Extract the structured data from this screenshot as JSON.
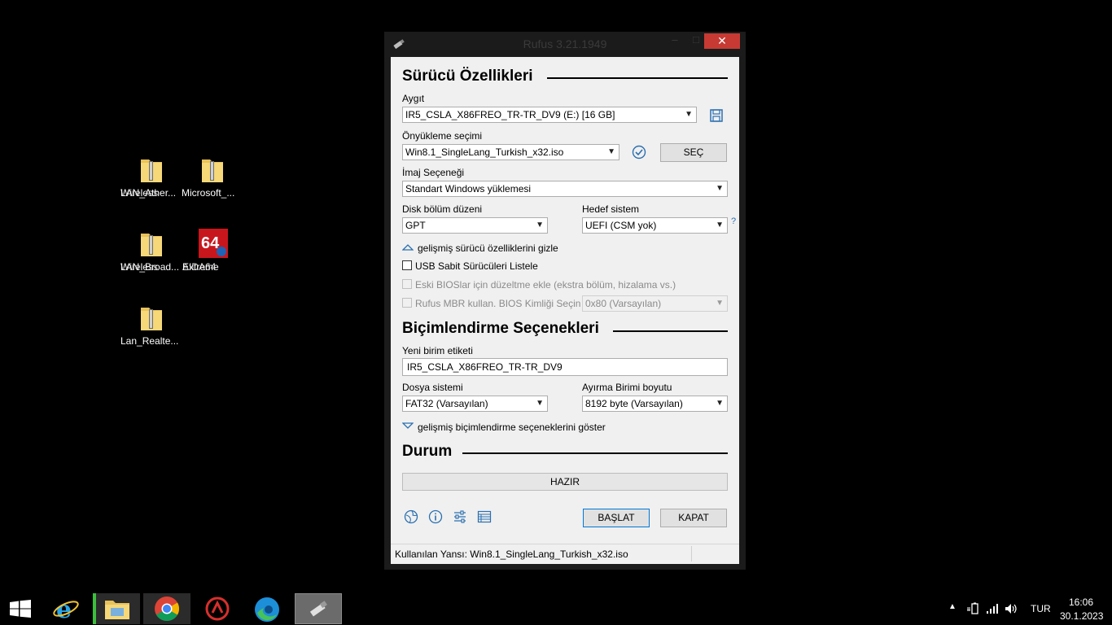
{
  "desktop": {
    "icons": [
      {
        "label1": "Wireless",
        "label2": "LAN_Ather..."
      },
      {
        "label1": "Microsoft_...",
        "label2": ""
      },
      {
        "label1": "Wireless",
        "label2": "LAN_Broad..."
      },
      {
        "label1": "AIDA64",
        "label2": "Extreme"
      },
      {
        "label1": "Lan_Realte...",
        "label2": ""
      }
    ]
  },
  "window": {
    "title": "Rufus 3.21.1949",
    "minimize": "–",
    "maximize": "□",
    "close": "✕"
  },
  "drive": {
    "section_title": "Sürücü Özellikleri",
    "device_label": "Aygıt",
    "device_value": "IR5_CSLA_X86FREO_TR-TR_DV9 (E:) [16 GB]",
    "boot_label": "Önyükleme seçimi",
    "boot_value": "Win8.1_SingleLang_Turkish_x32.iso",
    "select_button": "SEÇ",
    "image_option_label": "İmaj Seçeneği",
    "image_option_value": "Standart Windows yüklemesi",
    "partition_label": "Disk bölüm düzeni",
    "partition_value": "GPT",
    "target_label": "Hedef sistem",
    "target_value": "UEFI (CSM yok)",
    "help_mark": "?",
    "advanced_toggle": "gelişmiş sürücü özelliklerini gizle",
    "usb_list_label": "USB Sabit Sürücüleri Listele",
    "old_bios_label": "Eski BIOSlar için düzeltme ekle (ekstra bölüm, hizalama vs.)",
    "rufus_mbr_label": "Rufus MBR kullan. BIOS Kimliği Seçin",
    "bios_id_value": "0x80 (Varsayılan)"
  },
  "format": {
    "section_title": "Biçimlendirme Seçenekleri",
    "volume_label": "Yeni birim etiketi",
    "volume_value": "IR5_CSLA_X86FREO_TR-TR_DV9",
    "fs_label": "Dosya sistemi",
    "fs_value": "FAT32 (Varsayılan)",
    "cluster_label": "Ayırma Birimi boyutu",
    "cluster_value": "8192 byte (Varsayılan)",
    "advanced_toggle": "gelişmiş biçimlendirme seçeneklerini göster"
  },
  "status": {
    "section_title": "Durum",
    "progress_text": "HAZIR",
    "start_button": "BAŞLAT",
    "close_button": "KAPAT",
    "statusbar_text": "Kullanılan Yansı: Win8.1_SingleLang_Turkish_x32.iso"
  },
  "taskbar": {
    "language": "TUR",
    "time": "16:06",
    "date": "30.1.2023"
  },
  "colors": {
    "accent": "#0078d7",
    "close_red": "#c73a33",
    "icon_blue": "#2a6fb0"
  }
}
